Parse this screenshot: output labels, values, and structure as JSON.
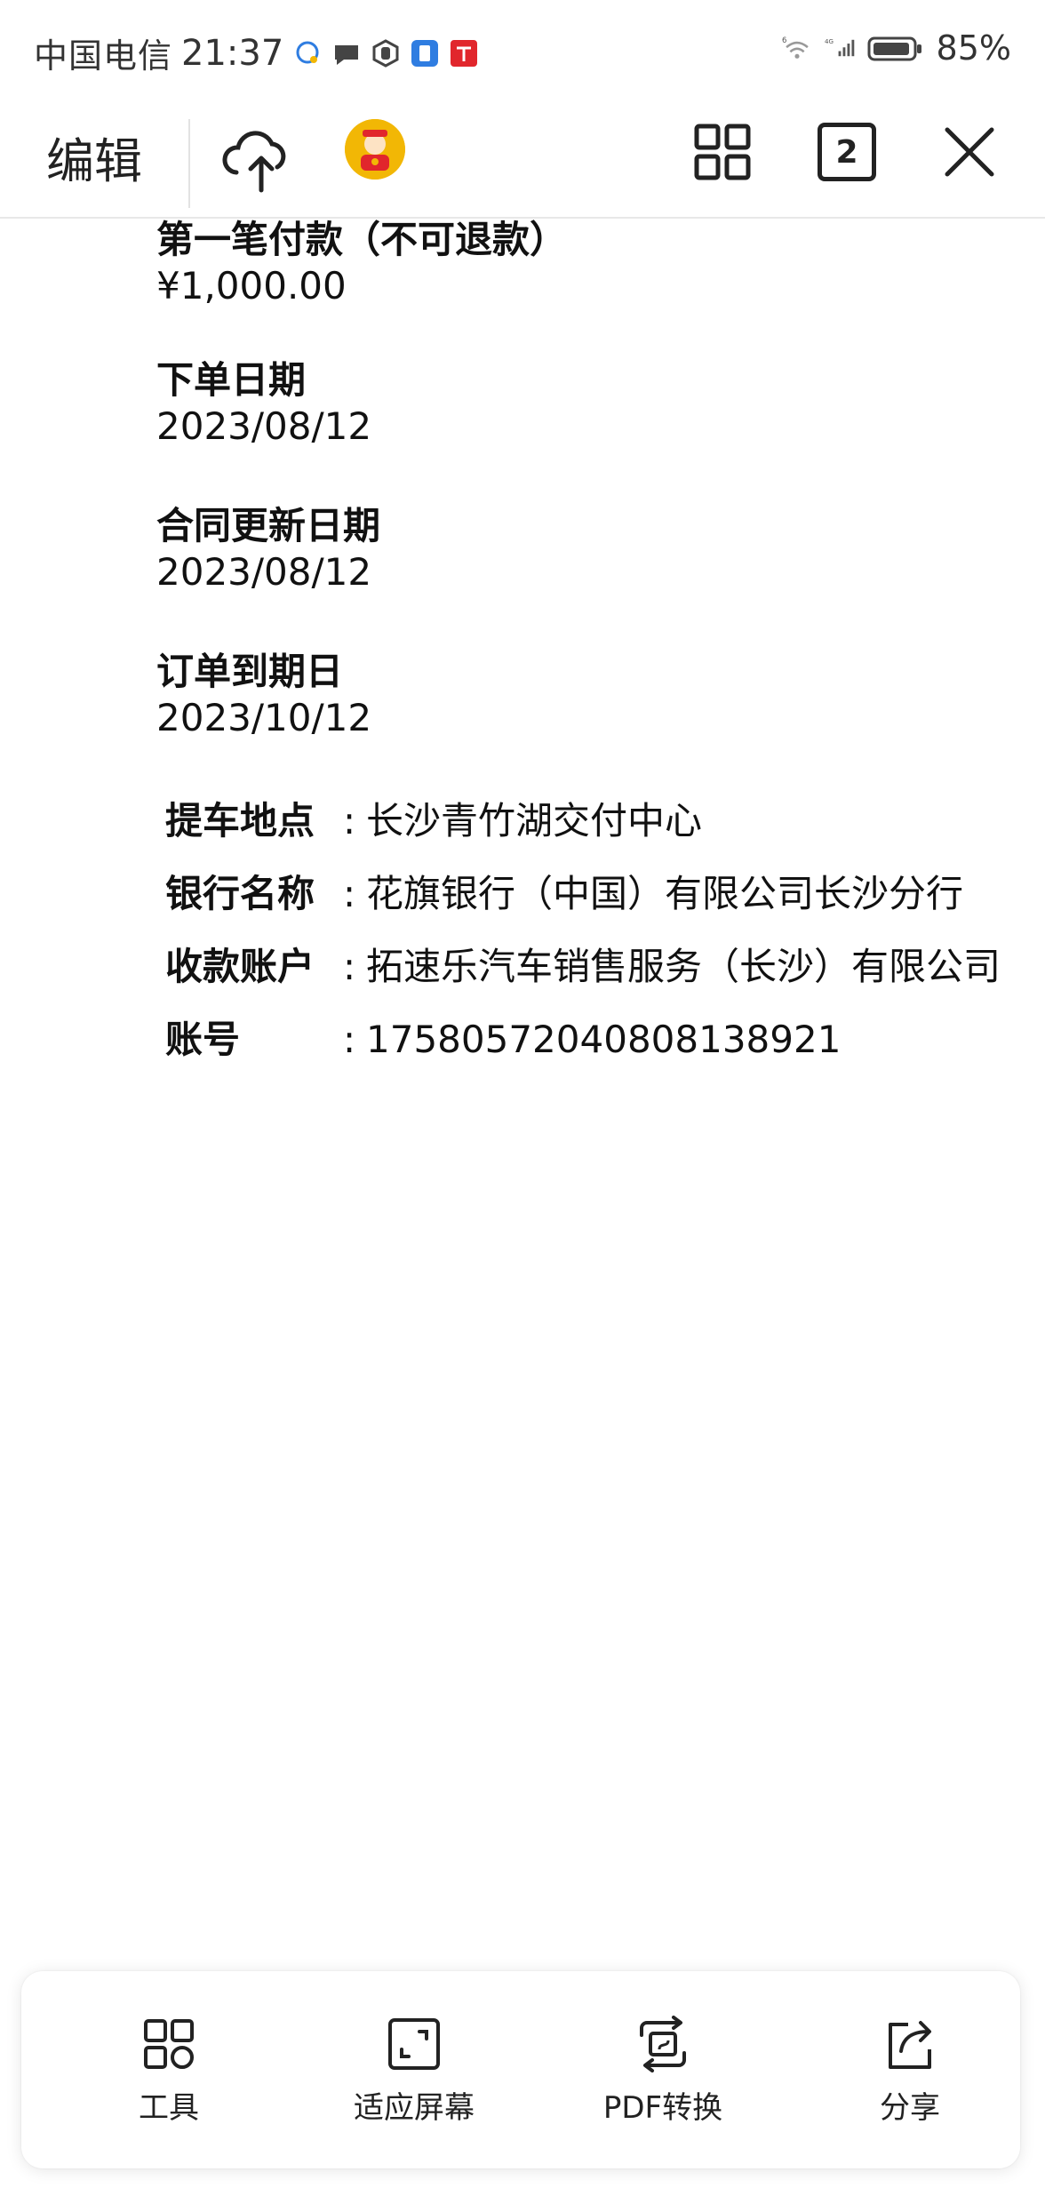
{
  "status_bar": {
    "carrier": "中国电信",
    "time": "21:37",
    "network_wifi": "6",
    "network_cell": "4G",
    "battery": "85%"
  },
  "toolbar": {
    "edit_label": "编辑",
    "page_count": "2"
  },
  "document": {
    "fields": [
      {
        "label": "第一笔付款（不可退款）",
        "value": "¥1,000.00"
      },
      {
        "label": "下单日期",
        "value": "2023/08/12"
      },
      {
        "label": "合同更新日期",
        "value": "2023/08/12"
      },
      {
        "label": "订单到期日",
        "value": "2023/10/12"
      }
    ],
    "details": [
      {
        "key": "提车地点",
        "sep": ":",
        "value": "长沙青竹湖交付中心"
      },
      {
        "key": "银行名称",
        "sep": ":",
        "value": "花旗银行（中国）有限公司长沙分行"
      },
      {
        "key": "收款账户",
        "sep": ":",
        "value": "拓速乐汽车销售服务（长沙）有限公司"
      },
      {
        "key": "账号",
        "sep": ":",
        "value": "17580572040808138921"
      }
    ]
  },
  "bottom_bar": {
    "items": [
      {
        "label": "工具",
        "icon": "tools-icon"
      },
      {
        "label": "适应屏幕",
        "icon": "fit-screen-icon"
      },
      {
        "label": "PDF转换",
        "icon": "pdf-convert-icon"
      },
      {
        "label": "分享",
        "icon": "share-icon"
      }
    ]
  },
  "colors": {
    "accent_red": "#e1262c",
    "accent_blue": "#2f7de1",
    "avatar_bg": "#f2b705"
  }
}
